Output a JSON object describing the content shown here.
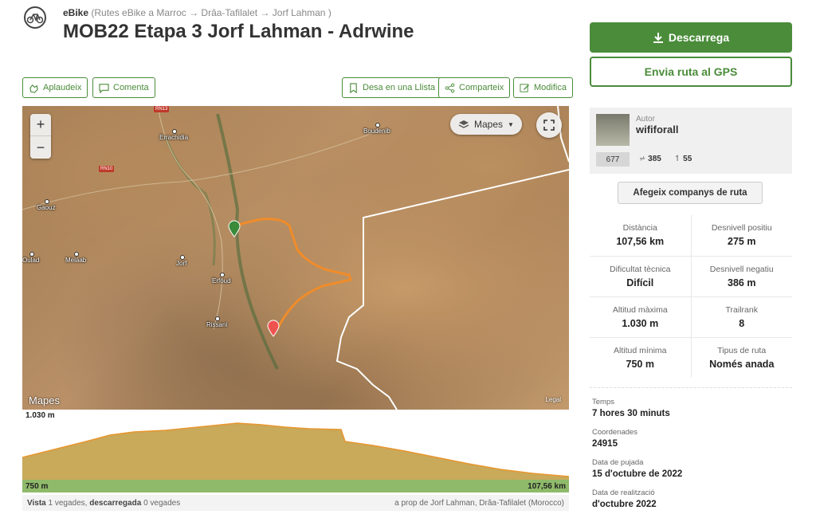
{
  "header": {
    "activity": "eBike",
    "breadcrumb": "(Rutes eBike a Marroc → Drâa-Tafilalet → Jorf Lahman )",
    "title": "MOB22 Etapa 3 Jorf Lahman - Adrwine"
  },
  "actions": {
    "applaud": "Aplaudeix",
    "comment": "Comenta",
    "save_list": "Desa en una Llista",
    "share": "Comparteix",
    "edit": "Modifica"
  },
  "map": {
    "map_type": "Mapes",
    "zoom_in": "+",
    "zoom_out": "−",
    "logo": "Mapes",
    "legal": "Legal",
    "places": [
      "Errachidia",
      "Boudenib",
      "Gaouz",
      "Oulad",
      "Meláab",
      "Jorf",
      "Erfoud",
      "Rissani"
    ],
    "roads": [
      "RN13",
      "RN10"
    ]
  },
  "profile": {
    "max_alt": "1.030 m",
    "min_alt": "750 m",
    "distance": "107,56 km"
  },
  "footer": {
    "views_label": "Vista",
    "views": "1 vegades,",
    "downloads_label": "descarregada",
    "downloads": "0 vegades",
    "location": "a prop de Jorf Lahman, Drâa-Tafilalet (Morocco)"
  },
  "sidebar": {
    "download": "Descarrega",
    "send_gps": "Envia ruta al GPS",
    "author_label": "Autor",
    "author_name": "wififorall",
    "author_count": "677",
    "author_followers": "385",
    "author_following": "55",
    "add_companions": "Afegeix companys de ruta"
  },
  "stats": [
    [
      {
        "label": "Distància",
        "value": "107,56 km"
      },
      {
        "label": "Desnivell positiu",
        "value": "275 m"
      }
    ],
    [
      {
        "label": "Dificultat tècnica",
        "value": "Difícil"
      },
      {
        "label": "Desnivell negatiu",
        "value": "386 m"
      }
    ],
    [
      {
        "label": "Altitud màxima",
        "value": "1.030 m"
      },
      {
        "label": "Trailrank",
        "value": "8"
      }
    ],
    [
      {
        "label": "Altitud mínima",
        "value": "750 m"
      },
      {
        "label": "Tipus de ruta",
        "value": "Només anada"
      }
    ]
  ],
  "details": [
    {
      "label": "Temps",
      "value": "7 hores 30 minuts"
    },
    {
      "label": "Coordenades",
      "value": "24915"
    },
    {
      "label": "Data de pujada",
      "value": "15 d'octubre de 2022"
    },
    {
      "label": "Data de realització",
      "value": "d'octubre 2022"
    }
  ],
  "colors": {
    "brand_green": "#4a8c3a",
    "route_orange": "#f08c2a",
    "profile_fill": "#c9a95a"
  }
}
